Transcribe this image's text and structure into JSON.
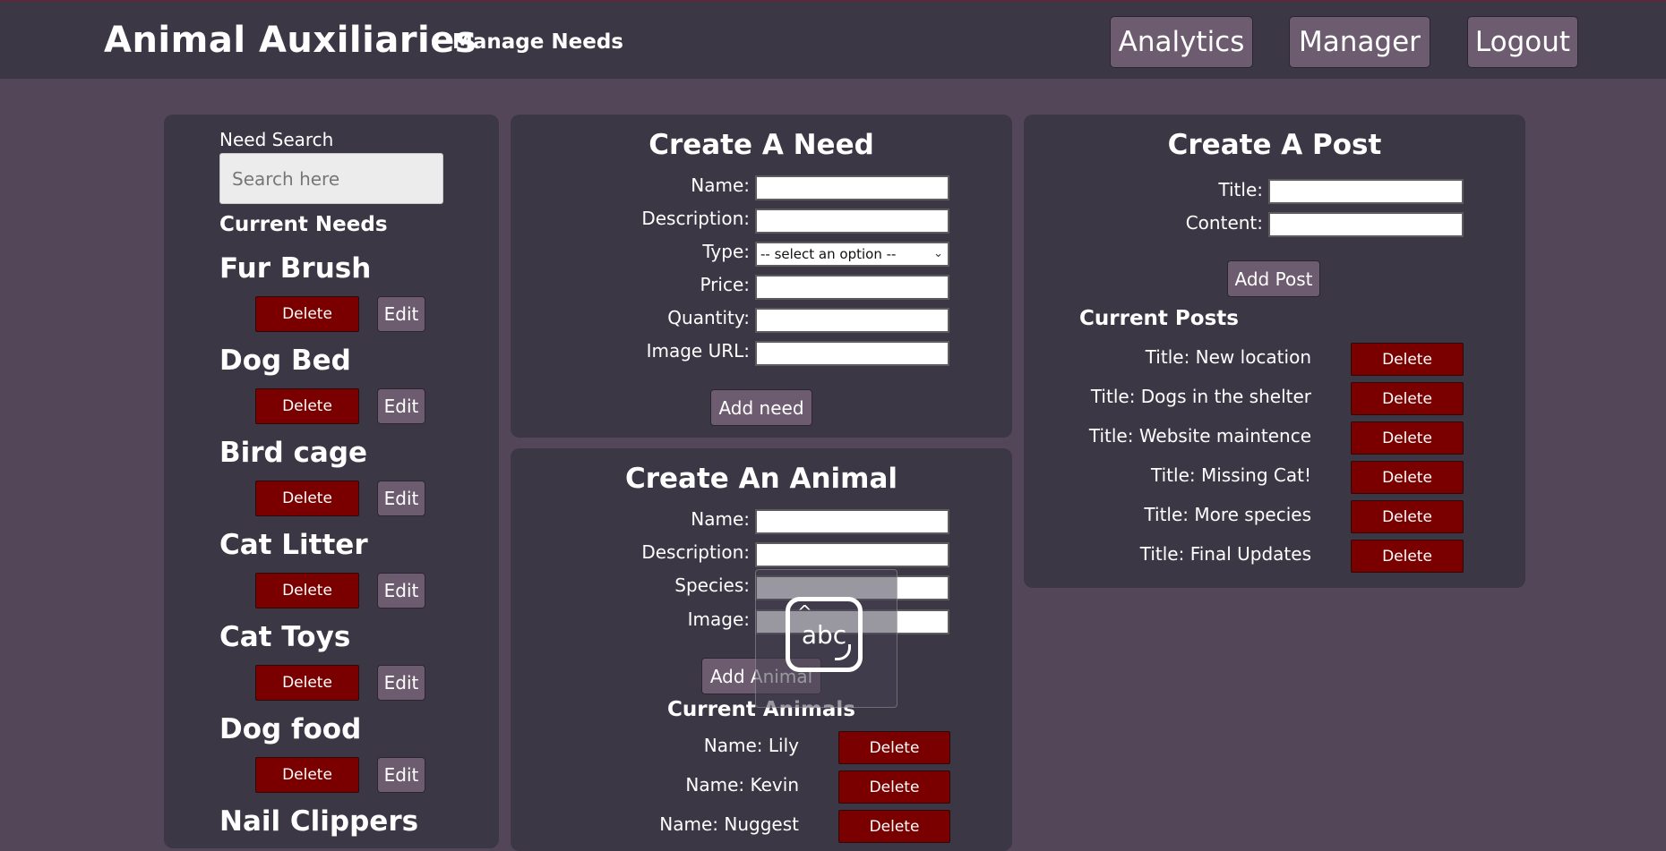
{
  "header": {
    "title": "Animal Auxiliaries",
    "subtitle": "Manage Needs",
    "nav": {
      "analytics": "Analytics",
      "manager": "Manager",
      "logout": "Logout"
    }
  },
  "needs_panel": {
    "search_label": "Need Search",
    "search_placeholder": "Search here",
    "current_heading": "Current Needs",
    "delete_label": "Delete",
    "edit_label": "Edit",
    "items": [
      "Fur Brush",
      "Dog Bed",
      "Bird cage",
      "Cat Litter",
      "Cat Toys",
      "Dog food",
      "Nail Clippers"
    ]
  },
  "create_need": {
    "title": "Create A Need",
    "name_label": "Name:",
    "description_label": "Description:",
    "type_label": "Type:",
    "type_selected": "-- select an option --",
    "price_label": "Price:",
    "quantity_label": "Quantity:",
    "image_url_label": "Image URL:",
    "submit_label": "Add need"
  },
  "create_animal": {
    "title": "Create An Animal",
    "name_label": "Name:",
    "description_label": "Description:",
    "species_label": "Species:",
    "image_label": "Image:",
    "submit_label": "Add Animal",
    "current_heading": "Current Animals",
    "delete_label": "Delete",
    "animals": [
      "Name: Lily",
      "Name: Kevin",
      "Name: Nuggest"
    ]
  },
  "create_post": {
    "title": "Create A Post",
    "title_label": "Title:",
    "content_label": "Content:",
    "submit_label": "Add Post",
    "current_heading": "Current Posts",
    "delete_label": "Delete",
    "posts": [
      "Title: New location",
      "Title: Dogs in the shelter",
      "Title: Website maintence",
      "Title: Missing Cat!",
      "Title: More species",
      "Title: Final Updates"
    ]
  },
  "ime": {
    "text": "abc",
    "caret": "^"
  }
}
